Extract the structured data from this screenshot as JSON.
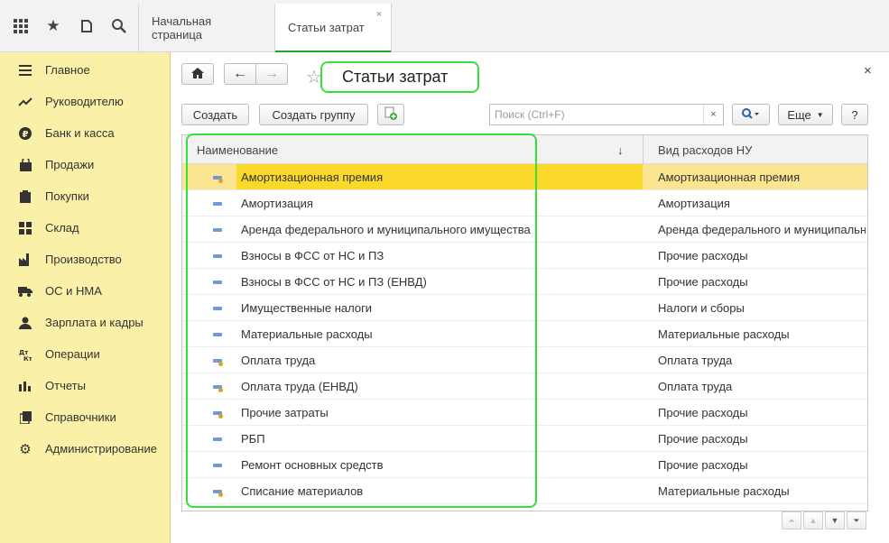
{
  "topbar": {
    "icons": [
      "apps-grid-icon",
      "star-icon",
      "history-icon",
      "search-icon"
    ],
    "tabs": [
      {
        "label": "Начальная страница"
      },
      {
        "label": "Статьи затрат",
        "close": "×"
      }
    ]
  },
  "sidebar": {
    "items": [
      {
        "label": "Главное",
        "icon": "menu-lines-icon"
      },
      {
        "label": "Руководителю",
        "icon": "trend-icon"
      },
      {
        "label": "Банк и касса",
        "icon": "ruble-coin-icon"
      },
      {
        "label": "Продажи",
        "icon": "bag-icon"
      },
      {
        "label": "Покупки",
        "icon": "cart-icon"
      },
      {
        "label": "Склад",
        "icon": "warehouse-icon"
      },
      {
        "label": "Производство",
        "icon": "factory-icon"
      },
      {
        "label": "ОС и НМА",
        "icon": "truck-icon"
      },
      {
        "label": "Зарплата и кадры",
        "icon": "people-icon"
      },
      {
        "label": "Операции",
        "icon": "debit-credit-icon"
      },
      {
        "label": "Отчеты",
        "icon": "bar-chart-icon"
      },
      {
        "label": "Справочники",
        "icon": "book-icon"
      },
      {
        "label": "Администрирование",
        "icon": "gear-icon"
      }
    ]
  },
  "form": {
    "title": "Статьи затрат",
    "close": "×",
    "toolbar": {
      "create": "Создать",
      "create_group": "Создать группу",
      "search_placeholder": "Поиск (Ctrl+F)",
      "search_clear": "×",
      "more": "Еще",
      "help": "?"
    }
  },
  "table": {
    "columns": [
      "Наименование",
      "Вид расходов НУ"
    ],
    "sort_indicator": "↓",
    "rows": [
      {
        "name": "Амортизационная премия",
        "type": "Амортизационная премия",
        "dot": true,
        "selected": true
      },
      {
        "name": "Амортизация",
        "type": "Амортизация",
        "dot": false
      },
      {
        "name": "Аренда федерального и муниципального имущества",
        "type": "Аренда федерального и муниципальн...",
        "dot": false
      },
      {
        "name": "Взносы в ФСС от НС и ПЗ",
        "type": "Прочие расходы",
        "dot": false
      },
      {
        "name": "Взносы в ФСС от НС и ПЗ (ЕНВД)",
        "type": "Прочие расходы",
        "dot": false
      },
      {
        "name": "Имущественные налоги",
        "type": "Налоги и сборы",
        "dot": false
      },
      {
        "name": "Материальные расходы",
        "type": "Материальные расходы",
        "dot": false
      },
      {
        "name": "Оплата труда",
        "type": "Оплата труда",
        "dot": true
      },
      {
        "name": "Оплата труда (ЕНВД)",
        "type": "Оплата труда",
        "dot": true
      },
      {
        "name": "Прочие затраты",
        "type": "Прочие расходы",
        "dot": true
      },
      {
        "name": "РБП",
        "type": "Прочие расходы",
        "dot": false
      },
      {
        "name": "Ремонт основных средств",
        "type": "Прочие расходы",
        "dot": false
      },
      {
        "name": "Списание материалов",
        "type": "Материальные расходы",
        "dot": true
      }
    ]
  },
  "colors": {
    "sidebar_bg": "#fbf0a7",
    "selection": "#fbd92a",
    "highlight": "#3ade3a"
  }
}
